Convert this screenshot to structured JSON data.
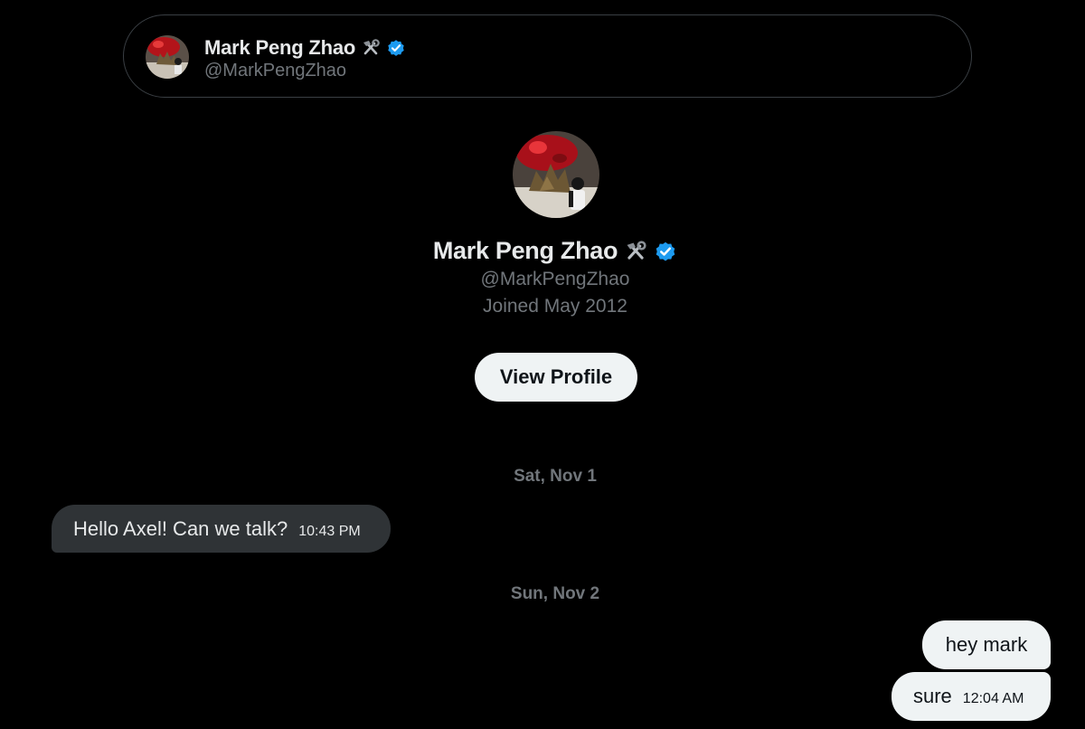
{
  "header": {
    "name": "Mark Peng Zhao",
    "handle": "@MarkPengZhao",
    "icons": [
      "hammer-and-wrench-icon",
      "verified-badge-icon"
    ]
  },
  "profile": {
    "name": "Mark Peng Zhao",
    "handle": "@MarkPengZhao",
    "joined": "Joined May 2012",
    "view_profile_label": "View Profile"
  },
  "conversation": {
    "groups": [
      {
        "date": "Sat, Nov 1",
        "messages": [
          {
            "direction": "incoming",
            "text": "Hello Axel! Can we talk?",
            "time": "10:43 PM"
          }
        ]
      },
      {
        "date": "Sun, Nov 2",
        "messages": [
          {
            "direction": "outgoing",
            "text": "hey mark",
            "time": ""
          },
          {
            "direction": "outgoing",
            "text": "sure",
            "time": "12:04 AM"
          }
        ]
      }
    ]
  },
  "colors": {
    "background": "#000000",
    "verified_blue": "#1d9bf0",
    "incoming_bubble": "#2f3336",
    "outgoing_bubble": "#eff3f4",
    "secondary_text": "#71767b"
  }
}
